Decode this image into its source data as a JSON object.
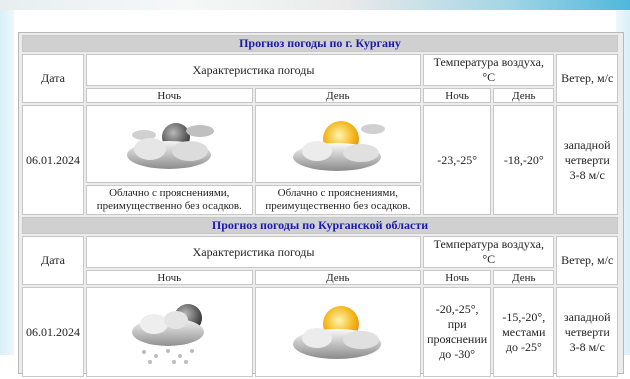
{
  "sections": [
    {
      "title": "Прогноз погоды по г. Кургану",
      "col_date": "Дата",
      "col_char": "Характеристика погоды",
      "col_temp": "Температура воздуха, °С",
      "col_wind": "Ветер, м/с",
      "night": "Ночь",
      "day": "День",
      "date": "06.01.2024",
      "night_icon": "cloud-moon-icon",
      "day_icon": "cloud-sun-icon",
      "night_desc": "Облачно с прояснениями, преимущественно без осадков.",
      "day_desc": "Облачно с прояснениями, преимущественно без осадков.",
      "temp_night": "-23,-25°",
      "temp_day": "-18,-20°",
      "wind": "западной четверти 3-8 м/с"
    },
    {
      "title": "Прогноз погоды по Курганской области",
      "col_date": "Дата",
      "col_char": "Характеристика погоды",
      "col_temp": "Температура воздуха, °С",
      "col_wind": "Ветер, м/с",
      "night": "Ночь",
      "day": "День",
      "date": "06.01.2024",
      "night_icon": "cloud-moon-snow-icon",
      "day_icon": "cloud-sun-icon",
      "temp_night": "-20,-25°, при прояснении до -30°",
      "temp_day": "-15,-20°, местами до -25°",
      "wind": "западной четверти 3-8 м/с"
    }
  ]
}
